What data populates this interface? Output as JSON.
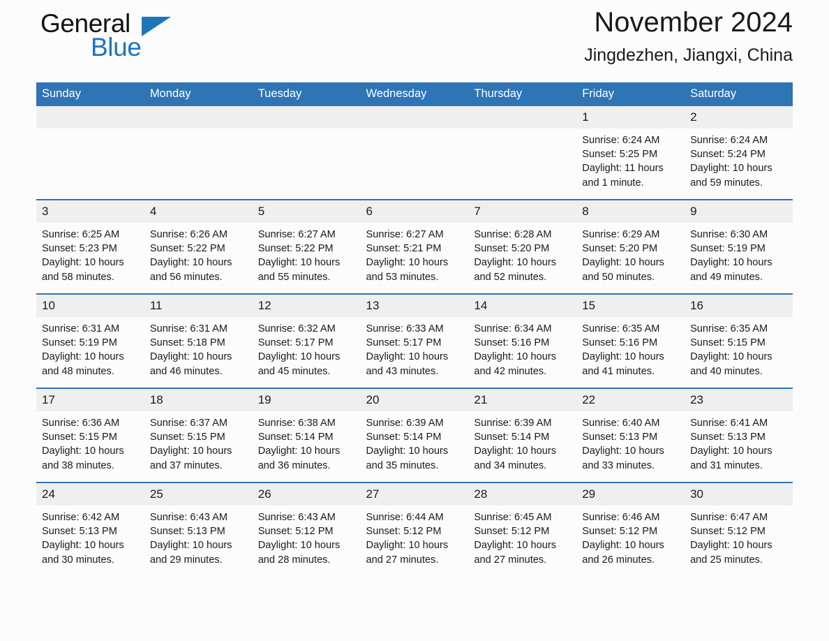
{
  "brand": {
    "name_part1": "General",
    "name_part2": "Blue"
  },
  "header": {
    "title": "November 2024",
    "subtitle": "Jingdezhen, Jiangxi, China"
  },
  "colors": {
    "header_blue": "#2f74b5",
    "brand_blue": "#1c76bc",
    "daynum_band": "#efefef",
    "page_background": "#fcfcfc"
  },
  "weekday_headers": [
    "Sunday",
    "Monday",
    "Tuesday",
    "Wednesday",
    "Thursday",
    "Friday",
    "Saturday"
  ],
  "weeks": [
    [
      {
        "day": "",
        "lines": []
      },
      {
        "day": "",
        "lines": []
      },
      {
        "day": "",
        "lines": []
      },
      {
        "day": "",
        "lines": []
      },
      {
        "day": "",
        "lines": []
      },
      {
        "day": "1",
        "lines": [
          "Sunrise: 6:24 AM",
          "Sunset: 5:25 PM",
          "Daylight: 11 hours and 1 minute."
        ]
      },
      {
        "day": "2",
        "lines": [
          "Sunrise: 6:24 AM",
          "Sunset: 5:24 PM",
          "Daylight: 10 hours and 59 minutes."
        ]
      }
    ],
    [
      {
        "day": "3",
        "lines": [
          "Sunrise: 6:25 AM",
          "Sunset: 5:23 PM",
          "Daylight: 10 hours and 58 minutes."
        ]
      },
      {
        "day": "4",
        "lines": [
          "Sunrise: 6:26 AM",
          "Sunset: 5:22 PM",
          "Daylight: 10 hours and 56 minutes."
        ]
      },
      {
        "day": "5",
        "lines": [
          "Sunrise: 6:27 AM",
          "Sunset: 5:22 PM",
          "Daylight: 10 hours and 55 minutes."
        ]
      },
      {
        "day": "6",
        "lines": [
          "Sunrise: 6:27 AM",
          "Sunset: 5:21 PM",
          "Daylight: 10 hours and 53 minutes."
        ]
      },
      {
        "day": "7",
        "lines": [
          "Sunrise: 6:28 AM",
          "Sunset: 5:20 PM",
          "Daylight: 10 hours and 52 minutes."
        ]
      },
      {
        "day": "8",
        "lines": [
          "Sunrise: 6:29 AM",
          "Sunset: 5:20 PM",
          "Daylight: 10 hours and 50 minutes."
        ]
      },
      {
        "day": "9",
        "lines": [
          "Sunrise: 6:30 AM",
          "Sunset: 5:19 PM",
          "Daylight: 10 hours and 49 minutes."
        ]
      }
    ],
    [
      {
        "day": "10",
        "lines": [
          "Sunrise: 6:31 AM",
          "Sunset: 5:19 PM",
          "Daylight: 10 hours and 48 minutes."
        ]
      },
      {
        "day": "11",
        "lines": [
          "Sunrise: 6:31 AM",
          "Sunset: 5:18 PM",
          "Daylight: 10 hours and 46 minutes."
        ]
      },
      {
        "day": "12",
        "lines": [
          "Sunrise: 6:32 AM",
          "Sunset: 5:17 PM",
          "Daylight: 10 hours and 45 minutes."
        ]
      },
      {
        "day": "13",
        "lines": [
          "Sunrise: 6:33 AM",
          "Sunset: 5:17 PM",
          "Daylight: 10 hours and 43 minutes."
        ]
      },
      {
        "day": "14",
        "lines": [
          "Sunrise: 6:34 AM",
          "Sunset: 5:16 PM",
          "Daylight: 10 hours and 42 minutes."
        ]
      },
      {
        "day": "15",
        "lines": [
          "Sunrise: 6:35 AM",
          "Sunset: 5:16 PM",
          "Daylight: 10 hours and 41 minutes."
        ]
      },
      {
        "day": "16",
        "lines": [
          "Sunrise: 6:35 AM",
          "Sunset: 5:15 PM",
          "Daylight: 10 hours and 40 minutes."
        ]
      }
    ],
    [
      {
        "day": "17",
        "lines": [
          "Sunrise: 6:36 AM",
          "Sunset: 5:15 PM",
          "Daylight: 10 hours and 38 minutes."
        ]
      },
      {
        "day": "18",
        "lines": [
          "Sunrise: 6:37 AM",
          "Sunset: 5:15 PM",
          "Daylight: 10 hours and 37 minutes."
        ]
      },
      {
        "day": "19",
        "lines": [
          "Sunrise: 6:38 AM",
          "Sunset: 5:14 PM",
          "Daylight: 10 hours and 36 minutes."
        ]
      },
      {
        "day": "20",
        "lines": [
          "Sunrise: 6:39 AM",
          "Sunset: 5:14 PM",
          "Daylight: 10 hours and 35 minutes."
        ]
      },
      {
        "day": "21",
        "lines": [
          "Sunrise: 6:39 AM",
          "Sunset: 5:14 PM",
          "Daylight: 10 hours and 34 minutes."
        ]
      },
      {
        "day": "22",
        "lines": [
          "Sunrise: 6:40 AM",
          "Sunset: 5:13 PM",
          "Daylight: 10 hours and 33 minutes."
        ]
      },
      {
        "day": "23",
        "lines": [
          "Sunrise: 6:41 AM",
          "Sunset: 5:13 PM",
          "Daylight: 10 hours and 31 minutes."
        ]
      }
    ],
    [
      {
        "day": "24",
        "lines": [
          "Sunrise: 6:42 AM",
          "Sunset: 5:13 PM",
          "Daylight: 10 hours and 30 minutes."
        ]
      },
      {
        "day": "25",
        "lines": [
          "Sunrise: 6:43 AM",
          "Sunset: 5:13 PM",
          "Daylight: 10 hours and 29 minutes."
        ]
      },
      {
        "day": "26",
        "lines": [
          "Sunrise: 6:43 AM",
          "Sunset: 5:12 PM",
          "Daylight: 10 hours and 28 minutes."
        ]
      },
      {
        "day": "27",
        "lines": [
          "Sunrise: 6:44 AM",
          "Sunset: 5:12 PM",
          "Daylight: 10 hours and 27 minutes."
        ]
      },
      {
        "day": "28",
        "lines": [
          "Sunrise: 6:45 AM",
          "Sunset: 5:12 PM",
          "Daylight: 10 hours and 27 minutes."
        ]
      },
      {
        "day": "29",
        "lines": [
          "Sunrise: 6:46 AM",
          "Sunset: 5:12 PM",
          "Daylight: 10 hours and 26 minutes."
        ]
      },
      {
        "day": "30",
        "lines": [
          "Sunrise: 6:47 AM",
          "Sunset: 5:12 PM",
          "Daylight: 10 hours and 25 minutes."
        ]
      }
    ]
  ]
}
